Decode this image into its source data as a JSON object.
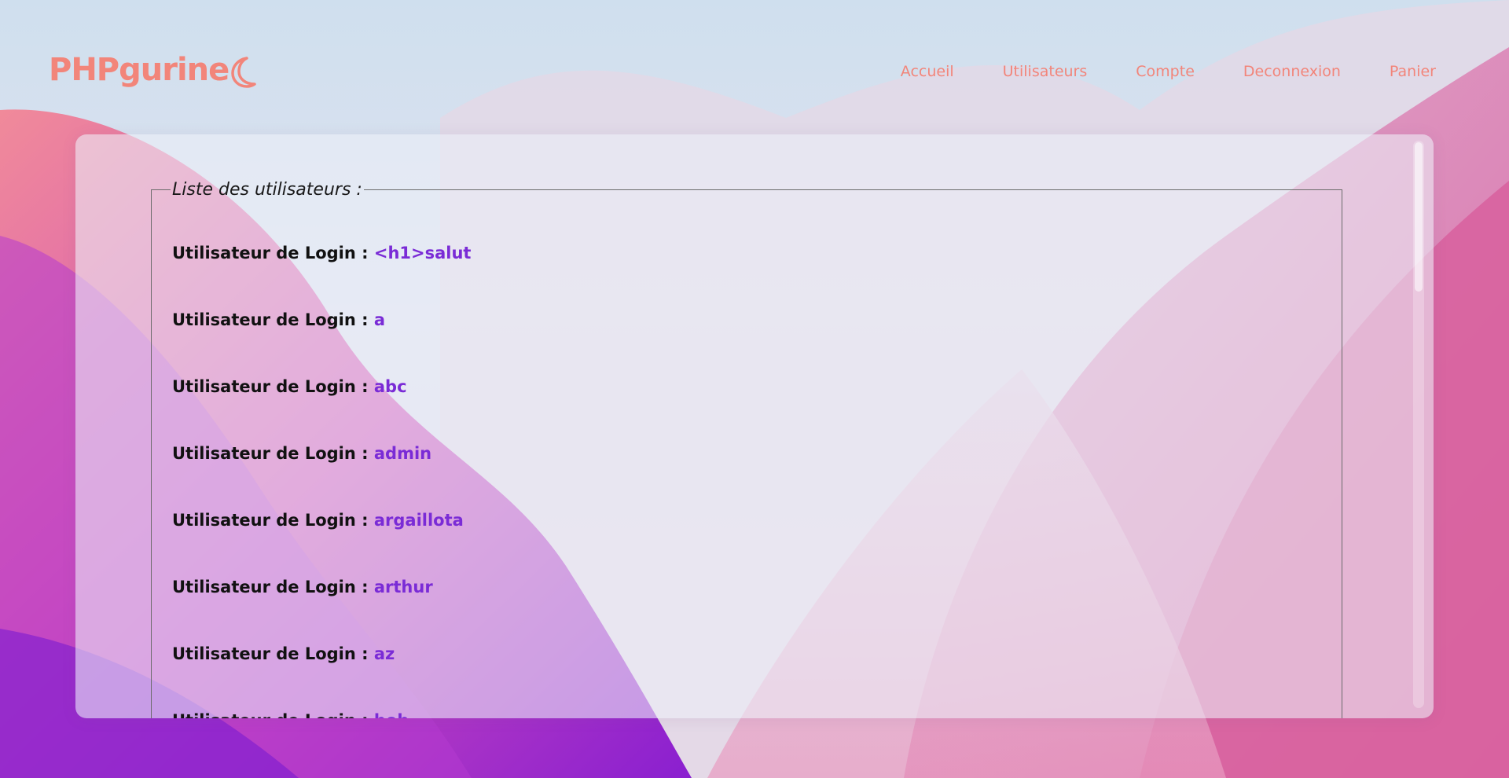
{
  "brand": {
    "name": "PHPgurine",
    "theme_toggle_icon": "moon-icon"
  },
  "nav": {
    "items": [
      {
        "label": "Accueil"
      },
      {
        "label": "Utilisateurs"
      },
      {
        "label": "Compte"
      },
      {
        "label": "Deconnexion"
      },
      {
        "label": "Panier"
      }
    ]
  },
  "users_section": {
    "legend": "Liste des utilisateurs :",
    "row_prefix": "Utilisateur de Login : ",
    "logins": [
      "<h1>salut",
      "a",
      "abc",
      "admin",
      "argaillota",
      "arthur",
      "az",
      "bob"
    ]
  },
  "colors": {
    "accent": "#f2857a",
    "login_value": "#7a2bd6"
  }
}
